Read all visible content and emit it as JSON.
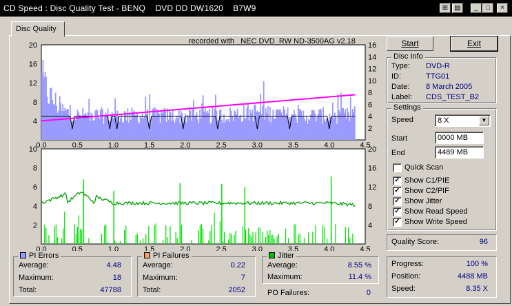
{
  "window": {
    "title": "CD Speed : Disc Quality Test - BENQ    DVD DD DW1620    B7W9",
    "buttons": [
      "⊞",
      "▤",
      "_",
      "□",
      "×"
    ]
  },
  "tab": {
    "label": "Disc Quality"
  },
  "recorded_with": "recorded with _NEC     DVD_RW ND-3500AG v2.18",
  "actions": {
    "start_label": "Start",
    "exit_label": "Exit"
  },
  "disc_info": {
    "legend": "Disc Info",
    "type_label": "Type:",
    "type_value": "DVD-R",
    "id_label": "ID:",
    "id_value": "TTG01",
    "date_label": "Date:",
    "date_value": "8 March 2005",
    "label_label": "Label:",
    "label_value": "CDS_TEST_B2"
  },
  "settings": {
    "legend": "Settings",
    "speed_label": "Speed",
    "speed_value": "8 X",
    "start_label": "Start",
    "start_value": "0000 MB",
    "end_label": "End",
    "end_value": "4489 MB",
    "options": [
      {
        "label": "Quick Scan",
        "checked": false
      },
      {
        "label": "Show C1/PIE",
        "checked": true
      },
      {
        "label": "Show C2/PIF",
        "checked": true
      },
      {
        "label": "Show Jitter",
        "checked": true
      },
      {
        "label": "Show Read Speed",
        "checked": true
      },
      {
        "label": "Show Write Speed",
        "checked": true
      }
    ]
  },
  "quality": {
    "label": "Quality Score:",
    "value": "96"
  },
  "progress": {
    "progress_label": "Progress:",
    "progress_value": "100 %",
    "position_label": "Position:",
    "position_value": "4488 MB",
    "speed_label": "Speed:",
    "speed_value": "8.35 X"
  },
  "pi_errors": {
    "legend": "PI Errors",
    "color": "#9a9aff",
    "average_label": "Average:",
    "average": "4.48",
    "maximum_label": "Maximum:",
    "maximum": "18",
    "total_label": "Total:",
    "total": "47788"
  },
  "pi_failures": {
    "legend": "PI Failures",
    "color": "#f0a060",
    "average_label": "Average:",
    "average": "0.22",
    "maximum_label": "Maximum:",
    "maximum": "7",
    "total_label": "Total:",
    "total": "2052"
  },
  "jitter": {
    "legend": "Jitter",
    "color": "#00c000",
    "average_label": "Average:",
    "average": "8.55 %",
    "maximum_label": "Maximum:",
    "maximum": "11.4 %",
    "po_label": "PO Failures:",
    "po_value": "0"
  },
  "chart_data": [
    {
      "type": "bar",
      "description_series": "PI Errors per ECC block with read speed",
      "x_ticks": [
        "0.0",
        "0.5",
        "1.0",
        "1.5",
        "2.0",
        "2.5",
        "3.0",
        "3.5",
        "4.0",
        "4.5"
      ],
      "xlim": [
        0,
        4.5
      ],
      "y_left_ticks": [
        "20",
        "16",
        "12",
        "8",
        "4"
      ],
      "ylim_left": [
        0,
        20
      ],
      "y_right_ticks": [
        "16",
        "14",
        "12",
        "10",
        "8",
        "6",
        "4",
        "2"
      ],
      "ylim_right": [
        0,
        16
      ],
      "series": [
        {
          "kind": "bars",
          "color": "#9a9aff",
          "x": [
            0.0,
            0.1,
            0.2,
            0.3,
            0.5,
            0.75,
            1.0,
            1.5,
            2.0,
            2.5,
            3.0,
            3.5,
            4.0,
            4.36
          ],
          "values": [
            15,
            11,
            9,
            7,
            6,
            6,
            6,
            6,
            6,
            6,
            7,
            6,
            6,
            6
          ]
        },
        {
          "kind": "line",
          "color": "#ff00ff",
          "x": [
            0,
            4.36
          ],
          "values": [
            3.2,
            7.6
          ]
        },
        {
          "kind": "line",
          "color": "#000000",
          "x": [
            0,
            4.36
          ],
          "values": [
            4.0,
            4.0
          ]
        }
      ]
    },
    {
      "type": "bar",
      "x_ticks": [
        "0.0",
        "0.5",
        "1.0",
        "1.5",
        "2.0",
        "2.5",
        "3.0",
        "3.5",
        "4.0",
        "4.5"
      ],
      "xlim": [
        0,
        4.5
      ],
      "y_left_ticks": [
        "10",
        "8",
        "6",
        "4",
        "2"
      ],
      "ylim_left": [
        0,
        10
      ],
      "y_right_ticks": [
        "20",
        "16",
        "12",
        "8",
        "4"
      ],
      "ylim_right": [
        0,
        20
      ],
      "series": [
        {
          "kind": "bars",
          "color": "#00e000",
          "x": [
            0.0,
            0.5,
            1.0,
            1.5,
            2.0,
            2.5,
            3.0,
            3.5,
            4.0,
            4.36
          ],
          "values": [
            1,
            2,
            1,
            2,
            1,
            1,
            1,
            2,
            1,
            1
          ]
        },
        {
          "kind": "line",
          "color": "#00a000",
          "x": [
            0.0,
            0.5,
            1.0,
            2.0,
            3.0,
            4.0,
            4.36
          ],
          "values": [
            8.6,
            11.4,
            8.6,
            8.6,
            8.6,
            8.6,
            8.2
          ]
        }
      ]
    }
  ]
}
